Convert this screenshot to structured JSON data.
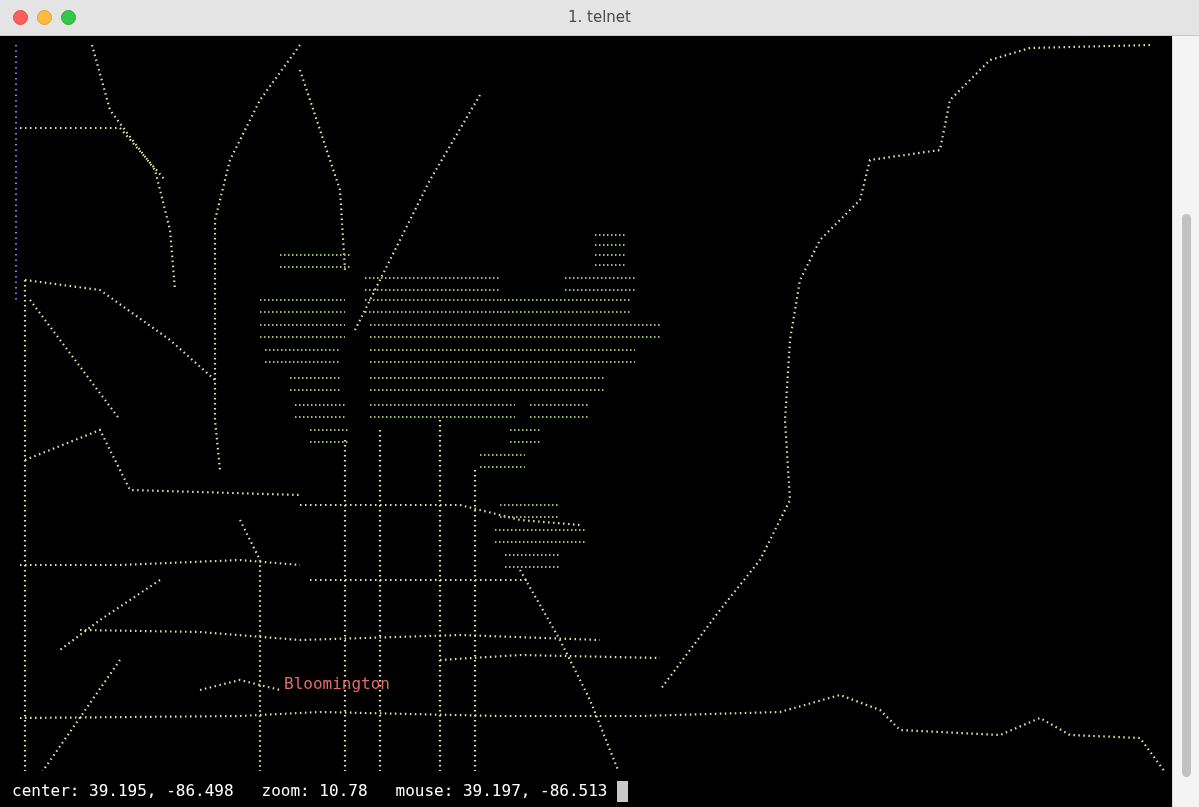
{
  "window": {
    "title": "1. telnet"
  },
  "map": {
    "labels": [
      {
        "text": "Bloomington"
      }
    ]
  },
  "status_line": {
    "center": "center: 39.195, -86.498",
    "zoom": "zoom: 10.78",
    "mouse": "mouse: 39.197, -86.513"
  }
}
